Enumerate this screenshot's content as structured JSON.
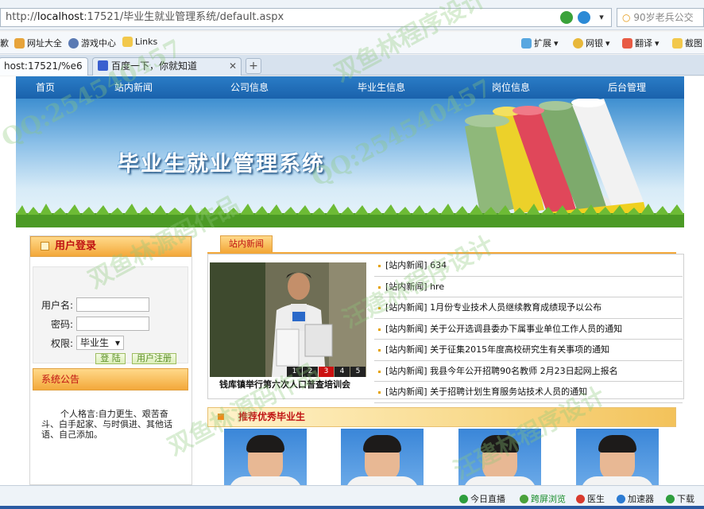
{
  "browser": {
    "url_prefix": "http://",
    "url_host": "localhost",
    "url_rest": ":17521/毕业生就业管理系统/default.aspx",
    "search_text": "90岁老兵公交",
    "favorites": [
      "歉",
      "网址大全",
      "游戏中心",
      "Links"
    ],
    "right_tools": [
      "扩展",
      "网银",
      "翻译",
      "截图"
    ],
    "tabs": [
      {
        "label": "host:17521/%e6",
        "active": true
      },
      {
        "label": "百度一下，你就知道",
        "active": false
      }
    ],
    "new_tab_symbol": "+"
  },
  "site": {
    "nav": [
      "首页",
      "站内新闻",
      "公司信息",
      "毕业生信息",
      "岗位信息",
      "后台管理"
    ],
    "banner_title": "毕业生就业管理系统"
  },
  "login": {
    "title": "用户登录",
    "username_label": "用户名:",
    "password_label": "密码:",
    "role_label": "权限:",
    "role_value": "毕业生",
    "login_button": "登 陆",
    "register_button": "用户注册"
  },
  "notice": {
    "title": "系统公告",
    "text": "个人格言:自力更生、艰苦奋斗、白手起家、与时俱进、其他话语、自己添加。"
  },
  "news": {
    "tab_label": "站内新闻",
    "photo_caption": "钱库镇举行第六次人口普查培训会",
    "slide_numbers": [
      "1",
      "2",
      "3",
      "4",
      "5"
    ],
    "current_slide": 3,
    "items": [
      "[站内新闻] 634",
      "[站内新闻] hre",
      "[站内新闻] 1月份专业技术人员继续教育成绩现予以公布",
      "[站内新闻] 关于公开选调县委办下属事业单位工作人员的通知",
      "[站内新闻] 关于征集2015年度高校研究生有关事项的通知",
      "[站内新闻] 我县今年公开招聘90名教师 2月23日起网上报名",
      "[站内新闻] 关于招聘计划生育服务站技术人员的通知"
    ]
  },
  "recommended": {
    "title": "推荐优秀毕业生"
  },
  "statusbar": {
    "items": [
      "今日直播",
      "跨屏浏览",
      "医生",
      "加速器",
      "下载"
    ]
  },
  "watermark": {
    "lines": [
      "双鱼林程序设计",
      "QQ:254540457",
      "汪建林程序设计",
      "双鱼林源码作品",
      "QQ:254540457",
      "汪建林程序设计",
      "双鱼林源码作品"
    ]
  },
  "colors": {
    "nav_blue": "#1f6eb8",
    "box_orange": "#f3a83a",
    "title_red": "#c01212"
  }
}
